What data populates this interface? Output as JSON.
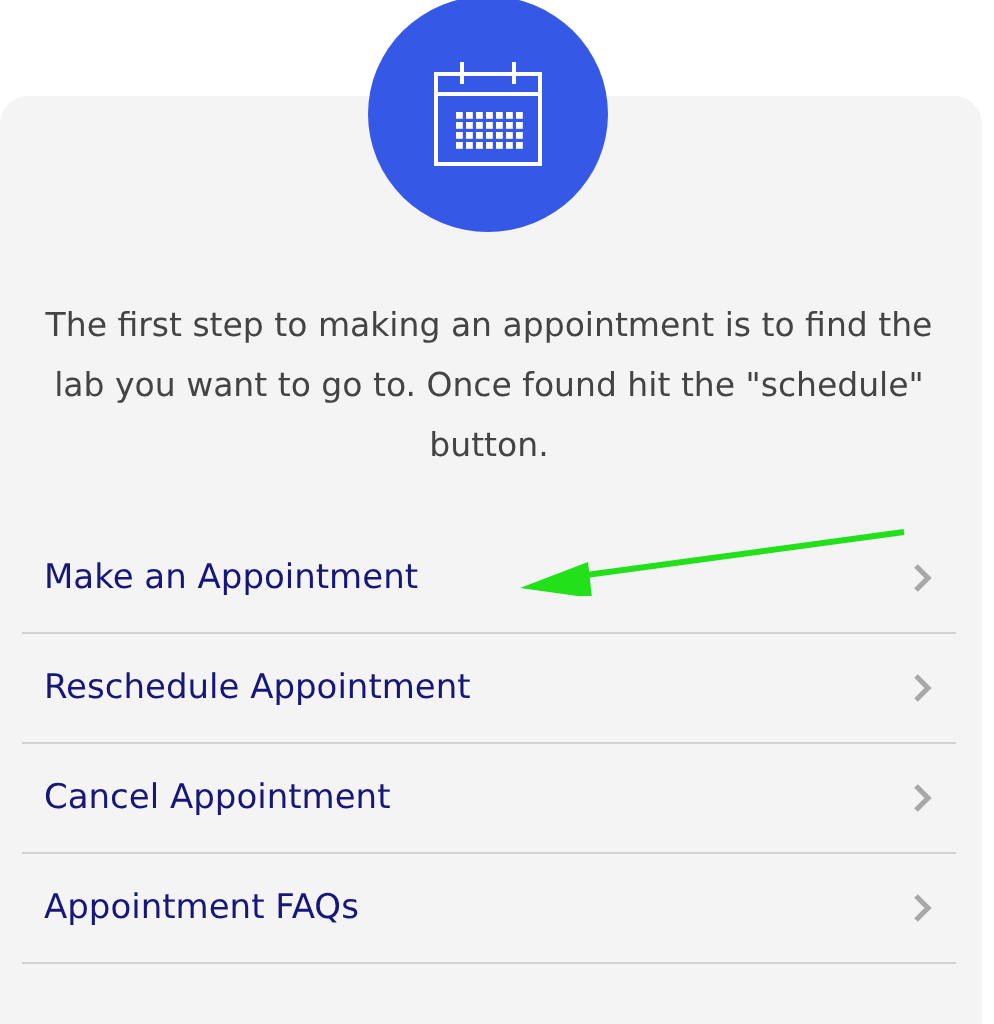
{
  "intro": "The first step to making an appointment is to find the lab you want to go to. Once found hit the \"schedule\" button.",
  "menu": [
    {
      "label": "Make an Appointment"
    },
    {
      "label": "Reschedule Appointment"
    },
    {
      "label": "Cancel Appointment"
    },
    {
      "label": "Appointment FAQs"
    }
  ]
}
